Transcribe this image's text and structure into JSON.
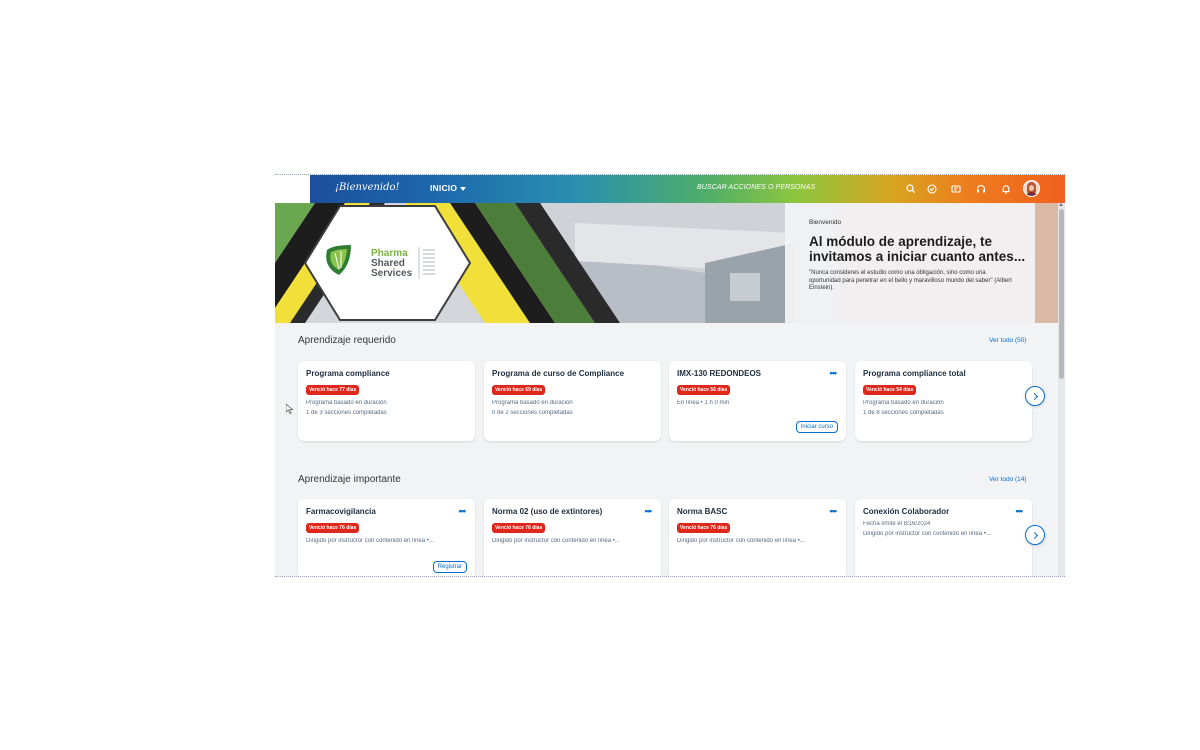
{
  "header": {
    "brand": "¡Bienvenido!",
    "nav_label": "INICIO",
    "search_placeholder": "BUSCAR ACCIONES O PERSONAS",
    "icons": [
      "search-icon",
      "check-circle-icon",
      "media-icon",
      "headset-icon",
      "bell-icon"
    ],
    "colors": {
      "start": "#1c4f9c",
      "mid": "#8cc63f",
      "end": "#f0611d"
    }
  },
  "hero": {
    "logo": {
      "line1": "Pharma",
      "line2": "Shared",
      "line3": "Services"
    },
    "welcome": "Bienvenido",
    "title": "Al módulo de aprendizaje, te invitamos a iniciar cuanto antes...",
    "quote": "\"Nunca consideres el estudio como una obligación, sino como una oportunidad para penetrar en el bello y maravilloso mundo del saber\" (Albert Einstein)."
  },
  "required": {
    "title": "Aprendizaje requerido",
    "see_all": "Ver todo (50)",
    "cards": [
      {
        "title": "Programa compliance",
        "badge": "Venció hace 77 días",
        "line1": "Programa basado en duración",
        "line2": "1 de 3 secciones completadas"
      },
      {
        "title": "Programa de curso de Compliance",
        "badge": "Venció hace 69 días",
        "line1": "Programa basado en duración",
        "line2": "0 de 2 secciones completadas"
      },
      {
        "title": "IMX-130 REDONDEOS",
        "badge": "Venció hace 56 días",
        "line1": "En línea • 1 h 0 min",
        "button": "Iniciar curso"
      },
      {
        "title": "Programa compliance total",
        "badge": "Venció hace 54 días",
        "line1": "Programa basado en duración",
        "line2": "1 de 8 secciones completadas"
      }
    ]
  },
  "important": {
    "title": "Aprendizaje importante",
    "see_all": "Ver todo (14)",
    "cards": [
      {
        "title": "Farmacovigilancia",
        "badge": "Venció hace 76 días",
        "line1": "Dirigido por instructor con contenido en línea •...",
        "button": "Registrar"
      },
      {
        "title": "Norma 02 (uso de extintores)",
        "badge": "Venció hace 76 días",
        "line1": "Dirigido por instructor con contenido en línea •..."
      },
      {
        "title": "Norma BASC",
        "badge": "Venció hace 76 días",
        "line1": "Dirigido por instructor con contenido en línea •..."
      },
      {
        "title": "Conexión Colaborador",
        "deadline": "Fecha límite el 8/16/2024",
        "line1": "Dirigido por instructor con contenido en línea •..."
      }
    ]
  }
}
